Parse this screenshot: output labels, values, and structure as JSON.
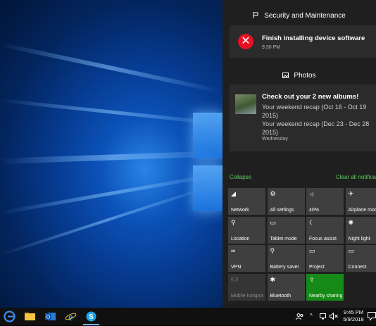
{
  "notifications": {
    "security": {
      "header": "Security and Maintenance",
      "title": "Finish installing device software",
      "time": "9:30 PM"
    },
    "photos": {
      "header": "Photos",
      "title": "Check out your 2 new albums!",
      "line1": "Your weekend recap (Oct 16 - Oct 19 2015)",
      "line2": "Your weekend recap (Dec 23 - Dec 28 2015)",
      "time": "Wednesday"
    }
  },
  "links": {
    "collapse": "Collapse",
    "clear_all": "Clear all notifications"
  },
  "quick_actions": [
    {
      "label": "Network",
      "icon": "network-icon",
      "state": "normal"
    },
    {
      "label": "All settings",
      "icon": "gear-icon",
      "state": "normal"
    },
    {
      "label": "40%",
      "icon": "brightness-icon",
      "state": "normal"
    },
    {
      "label": "Airplane mode",
      "icon": "airplane-icon",
      "state": "normal"
    },
    {
      "label": "Location",
      "icon": "location-icon",
      "state": "normal"
    },
    {
      "label": "Tablet mode",
      "icon": "tablet-icon",
      "state": "normal"
    },
    {
      "label": "Focus assist",
      "icon": "moon-icon",
      "state": "normal"
    },
    {
      "label": "Night light",
      "icon": "sun-icon",
      "state": "normal"
    },
    {
      "label": "VPN",
      "icon": "vpn-icon",
      "state": "normal"
    },
    {
      "label": "Battery saver",
      "icon": "battery-saver-icon",
      "state": "normal"
    },
    {
      "label": "Project",
      "icon": "project-icon",
      "state": "normal"
    },
    {
      "label": "Connect",
      "icon": "connect-icon",
      "state": "normal"
    },
    {
      "label": "Mobile hotspot",
      "icon": "hotspot-icon",
      "state": "disabled"
    },
    {
      "label": "Bluetooth",
      "icon": "bluetooth-icon",
      "state": "normal"
    },
    {
      "label": "Nearby sharing",
      "icon": "share-icon",
      "state": "active"
    }
  ],
  "taskbar": {
    "time": "9:45 PM",
    "date": "5/9/2018"
  },
  "colors": {
    "accent_active_tile": "#168a16",
    "link_green": "#5fcf5f",
    "error_red": "#e81123",
    "panel_bg": "#1f1f1f"
  }
}
